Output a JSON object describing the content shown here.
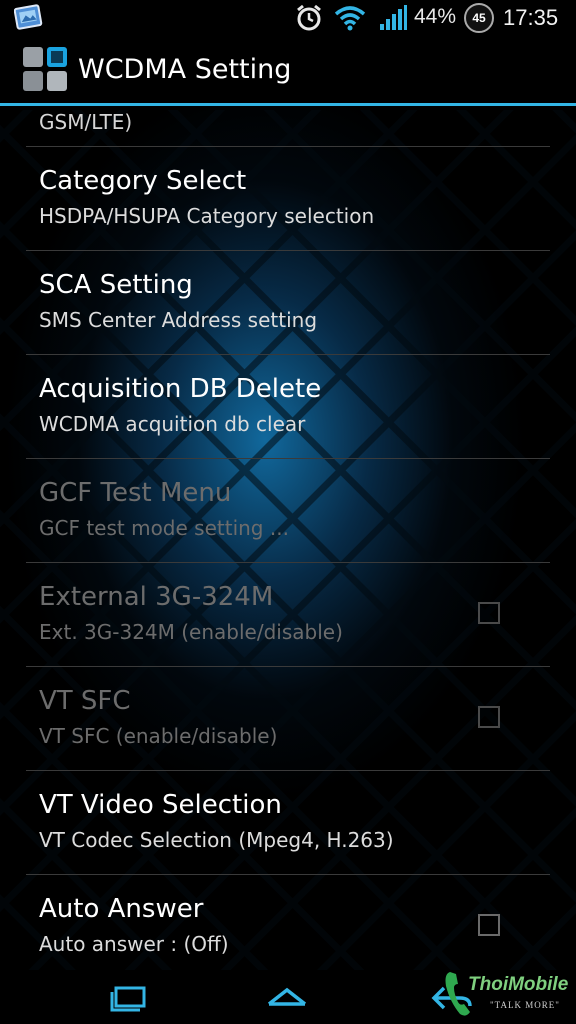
{
  "status_bar": {
    "battery": "44%",
    "badge": "45",
    "time": "17:35",
    "icons": [
      "gallery-notification-icon",
      "alarm-icon",
      "wifi-icon",
      "signal-icon",
      "battery-badge-icon"
    ]
  },
  "action_bar": {
    "title": "WCDMA Setting",
    "icon": "app-grid-icon"
  },
  "list": {
    "partial_text": "GSM/LTE)",
    "items": [
      {
        "title": "Category Select",
        "subtitle": "HSDPA/HSUPA Category selection",
        "enabled": true,
        "checkbox": false
      },
      {
        "title": "SCA Setting",
        "subtitle": "SMS Center Address setting",
        "enabled": true,
        "checkbox": false
      },
      {
        "title": "Acquisition DB Delete",
        "subtitle": "WCDMA acquition db clear",
        "enabled": true,
        "checkbox": false
      },
      {
        "title": "GCF Test Menu",
        "subtitle": "GCF test mode setting ...",
        "enabled": false,
        "checkbox": false
      },
      {
        "title": "External 3G-324M",
        "subtitle": "Ext. 3G-324M (enable/disable)",
        "enabled": false,
        "checkbox": true,
        "checked": false
      },
      {
        "title": "VT SFC",
        "subtitle": "VT SFC (enable/disable)",
        "enabled": false,
        "checkbox": true,
        "checked": false
      },
      {
        "title": "VT Video Selection",
        "subtitle": "VT Codec Selection (Mpeg4, H.263)",
        "enabled": true,
        "checkbox": false
      },
      {
        "title": "Auto Answer",
        "subtitle": "Auto answer : (Off)",
        "enabled": true,
        "checkbox": true,
        "checked": false
      }
    ]
  },
  "nav_bar": {
    "icons": [
      "recent-apps-icon",
      "home-icon",
      "back-icon"
    ]
  },
  "watermark": {
    "text": "ThoiMobile",
    "tagline": "\"TALK MORE\""
  },
  "colors": {
    "accent": "#33b5e5",
    "background": "#000000",
    "text_primary": "#ffffff",
    "text_disabled": "#6c6c6c"
  }
}
